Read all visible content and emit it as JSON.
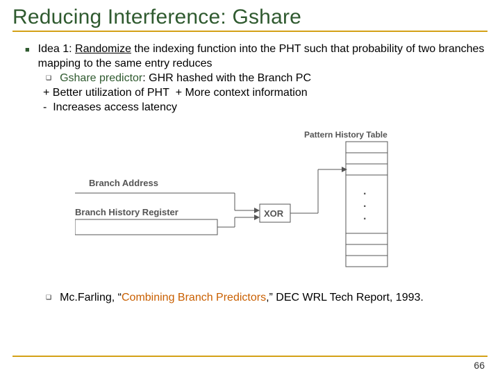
{
  "title": "Reducing Interference: Gshare",
  "idea": {
    "prefix": "Idea 1: ",
    "underlined": "Randomize",
    "rest": " the indexing function into the PHT such that probability of two branches mapping to the same entry reduces"
  },
  "sub": {
    "predictor_label": "Gshare predictor",
    "predictor_desc": ": GHR hashed with the Branch PC"
  },
  "plus_line": "+ Better utilization of PHT  + More context information",
  "minus_line": "-  Increases access latency",
  "diagram": {
    "pht_label": "Pattern History Table",
    "branch_addr": "Branch Address",
    "bhr": "Branch History Register",
    "xor": "XOR",
    "dot": "."
  },
  "citation": {
    "author": "Mc.Farling, “",
    "title": "Combining Branch Predictors",
    "rest": ",” DEC WRL Tech Report, 1993."
  },
  "page": "66"
}
